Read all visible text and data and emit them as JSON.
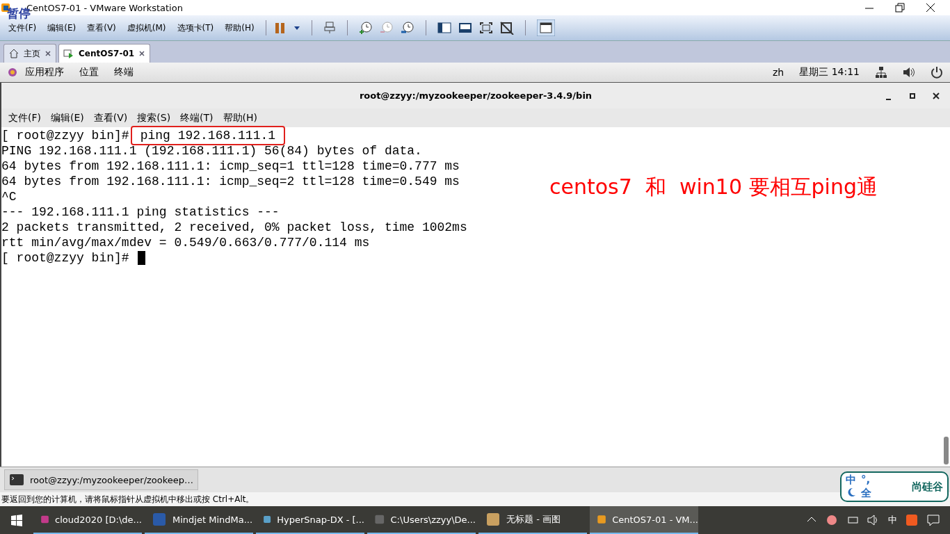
{
  "window": {
    "title": "CentOS7-01 - VMware Workstation",
    "overlay_label": "暂停"
  },
  "menu": [
    "文件(F)",
    "编辑(E)",
    "查看(V)",
    "虚拟机(M)",
    "选项卡(T)",
    "帮助(H)"
  ],
  "tabs": [
    {
      "label": "主页",
      "selected": false
    },
    {
      "label": "CentOS7-01",
      "selected": true
    }
  ],
  "gnome_bar": {
    "menus": [
      "应用程序",
      "位置",
      "终端"
    ],
    "lang": "zh",
    "clock": "星期三 14:11"
  },
  "terminal": {
    "title": "root@zzyy:/myzookeeper/zookeeper-3.4.9/bin",
    "menu": [
      "文件(F)",
      "编辑(E)",
      "查看(V)",
      "搜索(S)",
      "终端(T)",
      "帮助(H)"
    ],
    "lines": [
      {
        "kind": "prompt",
        "prompt": "[ root@zzyy bin]#",
        "command": "ping 192.168.111.1",
        "highlighted": true
      },
      {
        "kind": "output",
        "text": "PING 192.168.111.1 (192.168.111.1) 56(84) bytes of data."
      },
      {
        "kind": "output",
        "text": "64 bytes from 192.168.111.1: icmp_seq=1 ttl=128 time=0.777 ms"
      },
      {
        "kind": "output",
        "text": "64 bytes from 192.168.111.1: icmp_seq=2 ttl=128 time=0.549 ms"
      },
      {
        "kind": "output",
        "text": "^C"
      },
      {
        "kind": "output",
        "text": "--- 192.168.111.1 ping statistics ---"
      },
      {
        "kind": "output",
        "text": "2 packets transmitted, 2 received, 0% packet loss, time 1002ms"
      },
      {
        "kind": "output",
        "text": "rtt min/avg/max/mdev = 0.549/0.663/0.777/0.114 ms"
      },
      {
        "kind": "prompt",
        "prompt": "[ root@zzyy bin]#"
      }
    ],
    "annotation": "centos7  和  win10 要相互ping通"
  },
  "window_list": [
    {
      "label": "root@zzyy:/myzookeeper/zookeep…"
    }
  ],
  "status": "要返回到您的计算机，请将鼠标指针从虚拟机中移出或按 Ctrl+Alt。",
  "ime": {
    "chars": [
      "中",
      "°,",
      "全"
    ],
    "brand": "尚硅谷"
  },
  "taskbar": [
    {
      "label": "cloud2020 [D:\\de...",
      "selected": false
    },
    {
      "label": "Mindjet MindMa...",
      "selected": false
    },
    {
      "label": "HyperSnap-DX - [...",
      "selected": false
    },
    {
      "label": "C:\\Users\\zzyy\\De...",
      "selected": false
    },
    {
      "label": "无标题 - 画图",
      "selected": false
    },
    {
      "label": "CentOS7-01 - VM...",
      "selected": true
    }
  ],
  "tray": {
    "ime": "中"
  }
}
